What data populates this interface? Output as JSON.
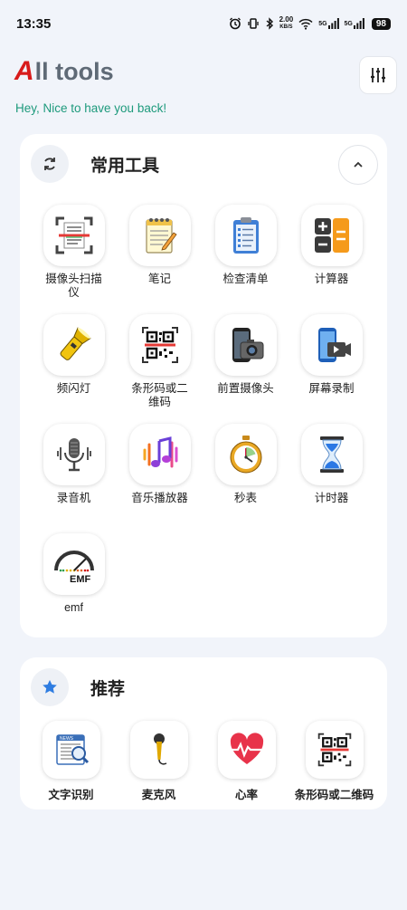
{
  "status_bar": {
    "time": "13:35",
    "net_speed_value": "2.00",
    "net_speed_unit": "KB/S",
    "signal_1": "5G",
    "signal_2": "5G",
    "battery": "98"
  },
  "header": {
    "title_logo_letter": "A",
    "title_rest": "ll tools",
    "subtitle": "Hey, Nice to have you back!"
  },
  "common_tools": {
    "title": "常用工具",
    "items": [
      {
        "label": "摄像头扫描仪",
        "icon": "document-scanner-icon"
      },
      {
        "label": "笔记",
        "icon": "notepad-icon"
      },
      {
        "label": "检查清单",
        "icon": "clipboard-checklist-icon"
      },
      {
        "label": "计算器",
        "icon": "calculator-icon"
      },
      {
        "label": "频闪灯",
        "icon": "flashlight-icon"
      },
      {
        "label": "条形码或二维码",
        "icon": "qr-barcode-icon"
      },
      {
        "label": "前置摄像头",
        "icon": "front-camera-icon"
      },
      {
        "label": "屏幕录制",
        "icon": "screen-record-icon"
      },
      {
        "label": "录音机",
        "icon": "microphone-recorder-icon"
      },
      {
        "label": "音乐播放器",
        "icon": "music-note-icon"
      },
      {
        "label": "秒表",
        "icon": "stopwatch-icon"
      },
      {
        "label": "计时器",
        "icon": "hourglass-icon"
      },
      {
        "label": "emf",
        "icon": "emf-meter-icon"
      }
    ]
  },
  "recommended": {
    "title": "推荐",
    "items": [
      {
        "label": "文字识别",
        "icon": "text-recognition-icon"
      },
      {
        "label": "麦克风",
        "icon": "microphone-icon"
      },
      {
        "label": "心率",
        "icon": "heart-rate-icon"
      },
      {
        "label": "条形码或二维码",
        "icon": "qr-barcode-icon"
      }
    ]
  },
  "colors": {
    "accent_green": "#1d9a7c",
    "logo_red": "#d81b1b",
    "background": "#f1f4fa",
    "star_blue": "#2f7de1"
  }
}
